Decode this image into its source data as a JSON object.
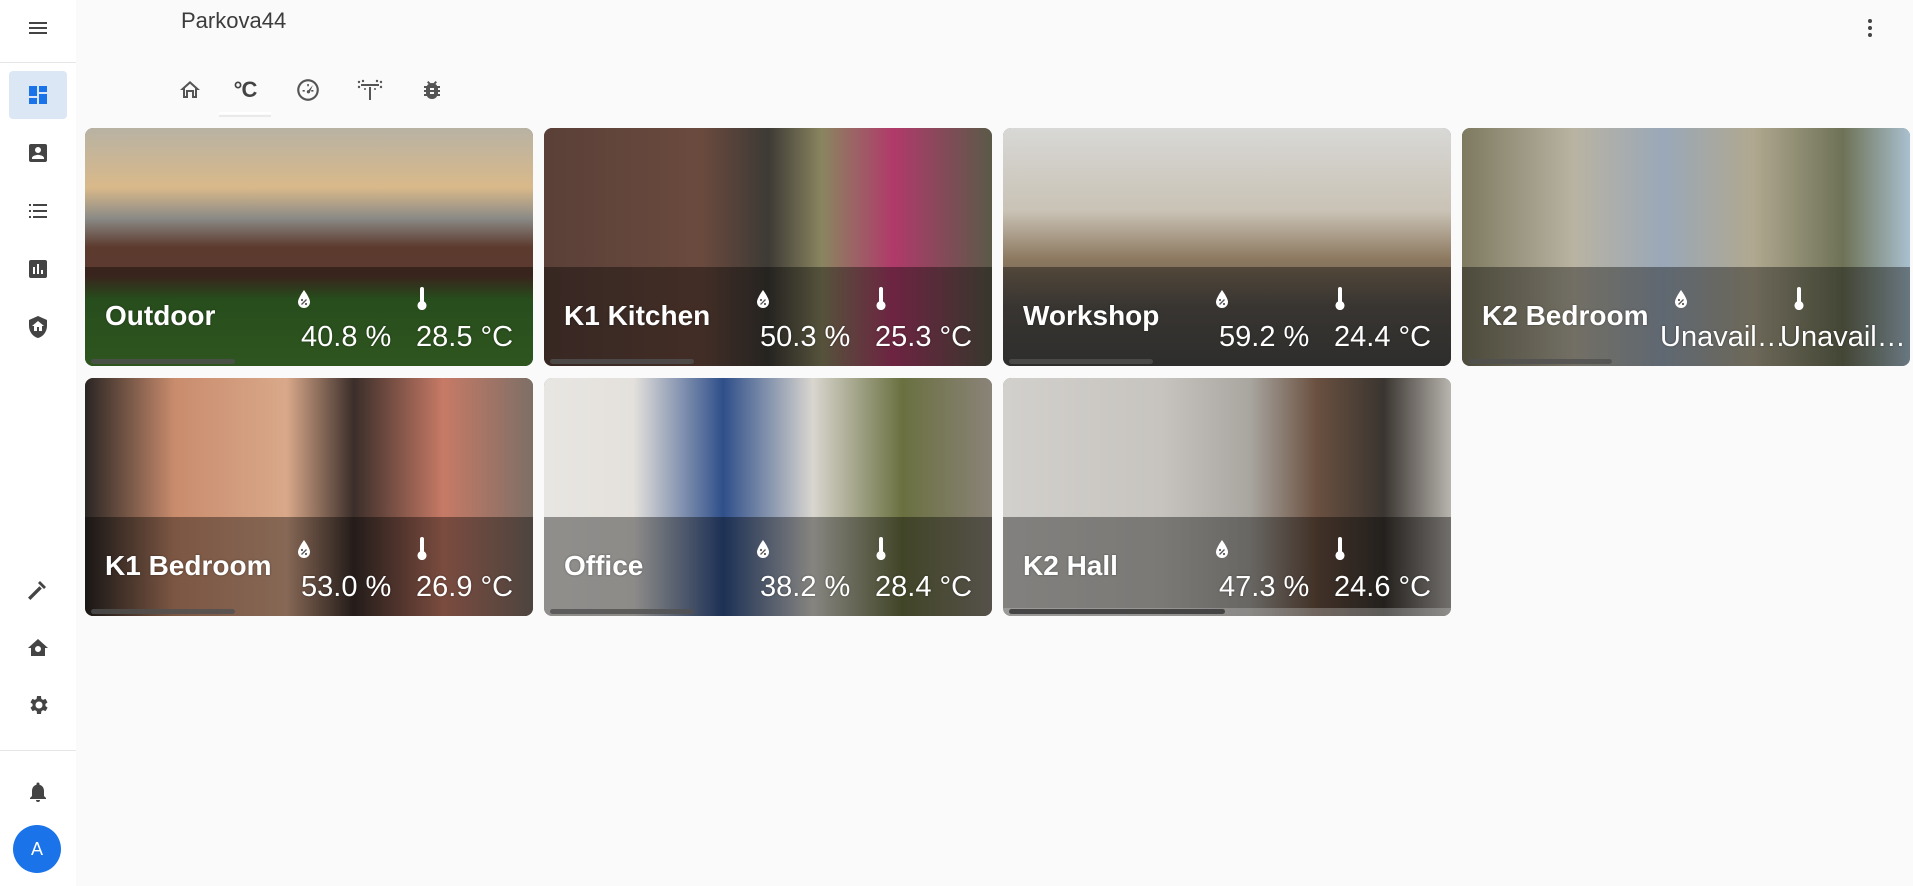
{
  "header": {
    "title": "Parkova44"
  },
  "sidebar": {
    "items": [
      {
        "name": "overview",
        "icon": "dashboard-icon",
        "active": true
      },
      {
        "name": "map",
        "icon": "account-box-icon"
      },
      {
        "name": "logbook",
        "icon": "list-icon"
      },
      {
        "name": "history",
        "icon": "chart-icon"
      },
      {
        "name": "security",
        "icon": "shield-home-icon"
      },
      {
        "name": "developer-tools",
        "icon": "hammer-icon"
      },
      {
        "name": "home-assistant",
        "icon": "home-gear-icon"
      },
      {
        "name": "settings",
        "icon": "gear-icon"
      },
      {
        "name": "notifications",
        "icon": "bell-icon"
      }
    ],
    "avatar_letter": "A"
  },
  "tabs": [
    {
      "name": "home",
      "icon": "home-icon"
    },
    {
      "name": "temperature",
      "label": "°C",
      "active": true
    },
    {
      "name": "gauge",
      "icon": "gauge-icon"
    },
    {
      "name": "sprinkler",
      "icon": "sprinkler-icon"
    },
    {
      "name": "bug",
      "icon": "bug-icon"
    }
  ],
  "rooms": [
    {
      "name": "Outdoor",
      "humidity": "40.8 %",
      "temperature": "28.5 °C",
      "theme": "outdoor"
    },
    {
      "name": "K1 Kitchen",
      "humidity": "50.3 %",
      "temperature": "25.3 °C",
      "theme": "kitchen"
    },
    {
      "name": "Workshop",
      "humidity": "59.2 %",
      "temperature": "24.4 °C",
      "theme": "workshop"
    },
    {
      "name": "K2 Bedroom",
      "humidity": "Unavail…",
      "temperature": "Unavail…",
      "theme": "bedroom2"
    },
    {
      "name": "K1 Bedroom",
      "humidity": "53.0 %",
      "temperature": "26.9 °C",
      "theme": "bedroom1"
    },
    {
      "name": "Office",
      "humidity": "38.2 %",
      "temperature": "28.4 °C",
      "theme": "office"
    },
    {
      "name": "K2 Hall",
      "humidity": "47.3 %",
      "temperature": "24.6 °C",
      "theme": "hall"
    }
  ],
  "colors": {
    "accent": "#1a73e8",
    "active_item_bg": "#dce7f6",
    "sidebar_icon": "#444444"
  }
}
